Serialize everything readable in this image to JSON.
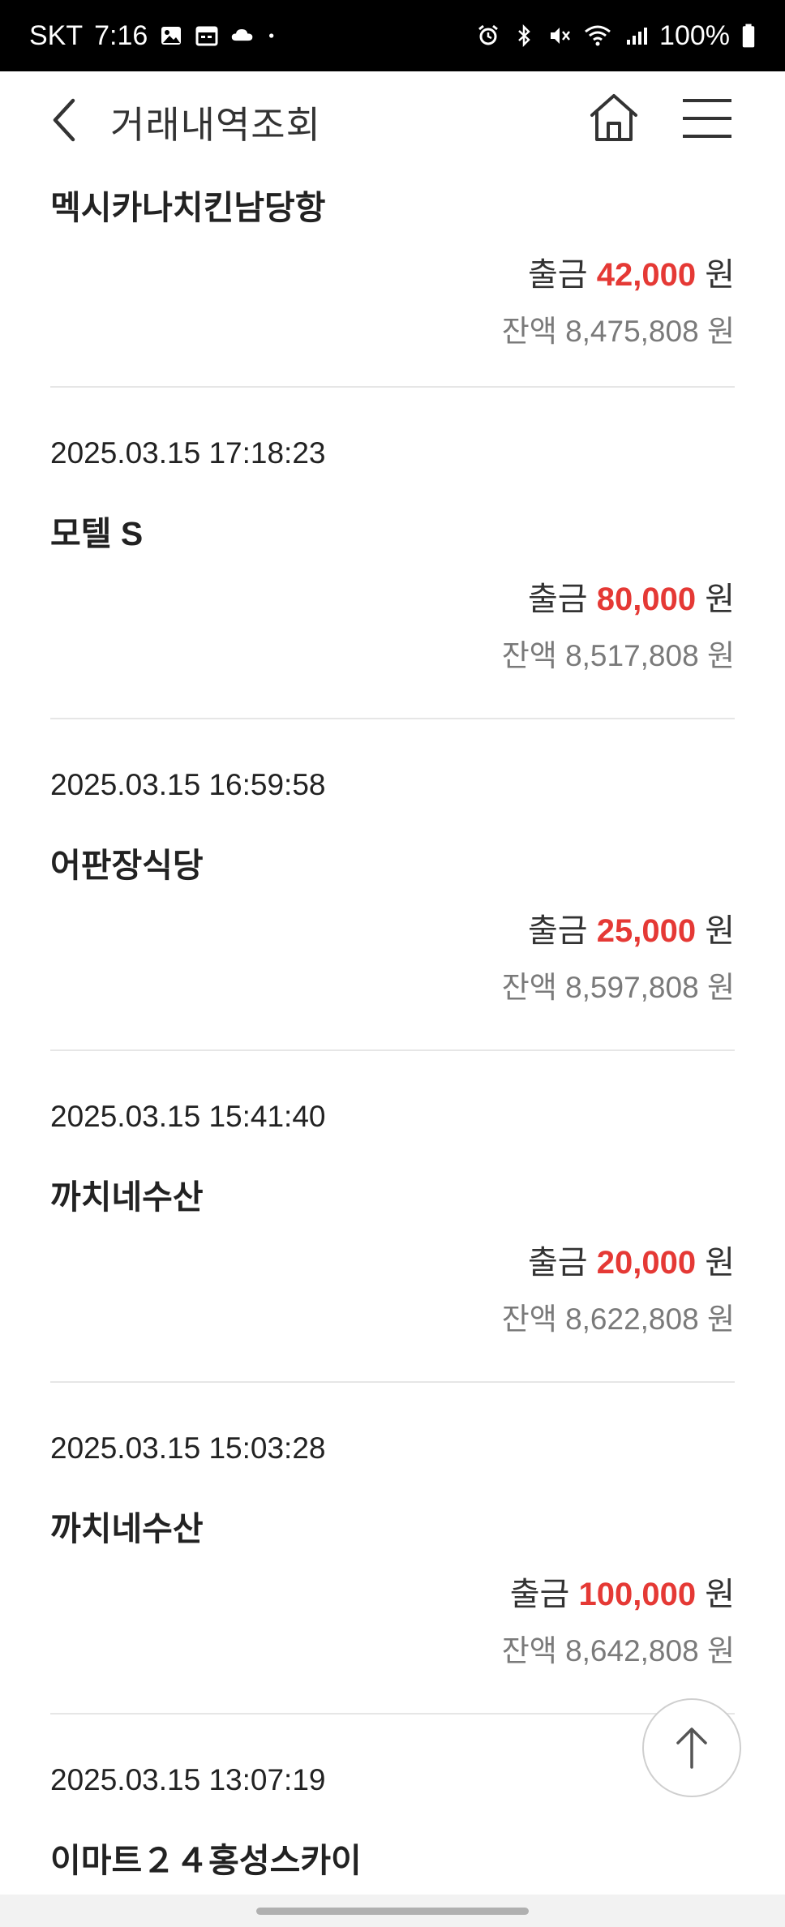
{
  "status_bar": {
    "carrier": "SKT",
    "time": "7:16",
    "battery": "100%"
  },
  "header": {
    "title": "거래내역조회"
  },
  "transactions": [
    {
      "date": "",
      "name": "멕시카나치킨남당항",
      "type_label": "출금",
      "amount": "42,000",
      "currency": "원",
      "balance_label": "잔액",
      "balance": "8,475,808"
    },
    {
      "date": "2025.03.15 17:18:23",
      "name": "모텔 S",
      "type_label": "출금",
      "amount": "80,000",
      "currency": "원",
      "balance_label": "잔액",
      "balance": "8,517,808"
    },
    {
      "date": "2025.03.15 16:59:58",
      "name": "어판장식당",
      "type_label": "출금",
      "amount": "25,000",
      "currency": "원",
      "balance_label": "잔액",
      "balance": "8,597,808"
    },
    {
      "date": "2025.03.15 15:41:40",
      "name": "까치네수산",
      "type_label": "출금",
      "amount": "20,000",
      "currency": "원",
      "balance_label": "잔액",
      "balance": "8,622,808"
    },
    {
      "date": "2025.03.15 15:03:28",
      "name": "까치네수산",
      "type_label": "출금",
      "amount": "100,000",
      "currency": "원",
      "balance_label": "잔액",
      "balance": "8,642,808"
    },
    {
      "date": "2025.03.15 13:07:19",
      "name": "이마트２４홍성스카이",
      "type_label": "",
      "amount": "",
      "currency": "",
      "balance_label": "",
      "balance": ""
    }
  ],
  "icons": {
    "back": "chevron-left-icon",
    "home": "home-icon",
    "menu": "hamburger-menu-icon",
    "scroll_top": "arrow-up-icon"
  },
  "colors": {
    "withdrawal_amount": "#e53935",
    "balance_text": "#7a7a7a",
    "divider": "#e6e6e6"
  }
}
